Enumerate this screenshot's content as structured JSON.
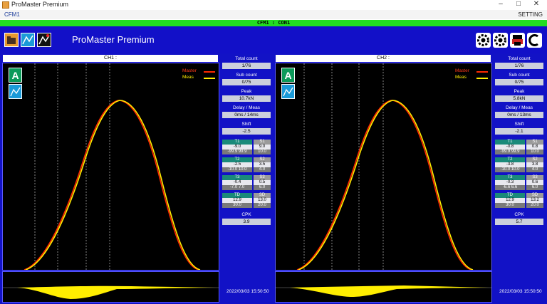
{
  "window": {
    "title": "ProMaster Premium"
  },
  "menu": {
    "left": "CFM1",
    "right": "SETTING"
  },
  "status": {
    "text": "CFM1 : CON1"
  },
  "header": {
    "title": "ProMaster Premium"
  },
  "channels": [
    {
      "label": "CH1 :",
      "legend": {
        "master": "Master",
        "meas": "Meas"
      },
      "badge": "A",
      "stats": {
        "total_count_label": "Total count",
        "total_count": "1/76",
        "sub_count_label": "Sub count",
        "sub_count": "0/75",
        "peak_label": "Peak",
        "peak": "10.7kN",
        "delay_label": "Delay / Meas",
        "delay": "0ms / 14ms",
        "shift_label": "Shift",
        "shift": "-2.5",
        "cpk_label": "CPK",
        "cpk": "3.9"
      },
      "tables": [
        {
          "t_hdr": "T1",
          "s_hdr": "S1",
          "t_val": "-9.0",
          "s_val": "9.0",
          "t_rng": "-99.9 99.9",
          "s_rng": "10.0"
        },
        {
          "t_hdr": "T2",
          "s_hdr": "S2",
          "t_val": "-2.5",
          "s_val": "3.5",
          "t_rng": "-10.0 10.0",
          "s_rng": "4.0"
        },
        {
          "t_hdr": "T3",
          "s_hdr": "S3",
          "t_val": "-0.4",
          "s_val": "0.5",
          "t_rng": "-7.0 7.0",
          "s_rng": "6.0"
        },
        {
          "t_hdr": "TD",
          "s_hdr": "SD",
          "t_val": "12.9",
          "s_val": "13.0",
          "t_rng": "30.0",
          "s_rng": "20.0"
        }
      ],
      "datetime": "2022/03/03 15:50:50"
    },
    {
      "label": "CH2 :",
      "legend": {
        "master": "Master",
        "meas": "Meas"
      },
      "badge": "A",
      "stats": {
        "total_count_label": "Total count",
        "total_count": "1/76",
        "sub_count_label": "Sub count",
        "sub_count": "0/75",
        "peak_label": "Peak",
        "peak": "5.8kN",
        "delay_label": "Delay / Meas",
        "delay": "0ms / 13ms",
        "shift_label": "Shift",
        "shift": "-2.1",
        "cpk_label": "CPK",
        "cpk": "5.7"
      },
      "tables": [
        {
          "t_hdr": "T1",
          "s_hdr": "S1",
          "t_val": "-0.8",
          "s_val": "0.8",
          "t_rng": "-99.9 99.9",
          "s_rng": "10.0"
        },
        {
          "t_hdr": "T2",
          "s_hdr": "S2",
          "t_val": "-3.8",
          "s_val": "3.8",
          "t_rng": "-10.0 10.0",
          "s_rng": "4.0"
        },
        {
          "t_hdr": "T3",
          "s_hdr": "S3",
          "t_val": "-0.3",
          "s_val": "0.6",
          "t_rng": "-6.6 6.6",
          "s_rng": "6.0"
        },
        {
          "t_hdr": "TD",
          "s_hdr": "SD",
          "t_val": "12.9",
          "s_val": "13.2",
          "t_rng": "30.0",
          "s_rng": "20.0"
        }
      ],
      "datetime": "2022/03/03 15:50:50"
    }
  ],
  "colors": {
    "header_bg": "#1210c8",
    "plot_bg": "#000000",
    "master_line": "#ff2a00",
    "meas_line": "#ffee00",
    "status_bar": "#22dd22"
  },
  "icons": [
    "app-icon",
    "gear-icon",
    "print-icon",
    "exit-icon",
    "chart-icon"
  ]
}
